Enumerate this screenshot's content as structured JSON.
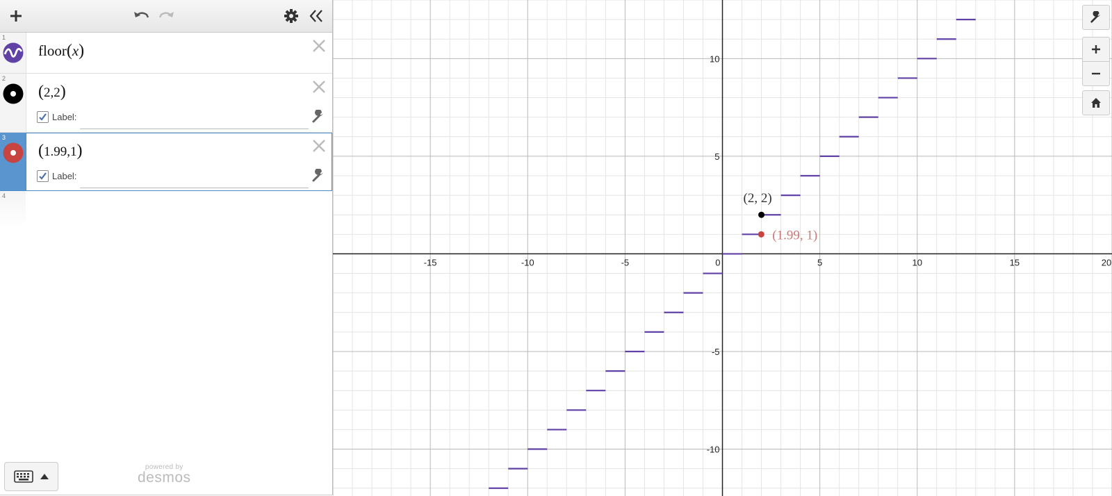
{
  "toolbar": {
    "add": "add-expression",
    "undo": "undo",
    "redo": "redo",
    "settings": "settings",
    "collapse": "collapse-list"
  },
  "expressions": [
    {
      "index": "1",
      "latex": "floor(x)",
      "color": "#6042a6",
      "type": "function"
    },
    {
      "index": "2",
      "latex": "(2,2)",
      "color": "#000000",
      "type": "point",
      "label_text": "Label:",
      "label_checked": true
    },
    {
      "index": "3",
      "latex": "(1.99,1)",
      "color": "#c74440",
      "type": "point",
      "label_text": "Label:",
      "label_checked": true,
      "selected": true
    },
    {
      "index": "4"
    }
  ],
  "footer": {
    "powered_by": "powered by",
    "brand": "desmos"
  },
  "graph": {
    "x_ticks": [
      "-15",
      "-10",
      "-5",
      "0",
      "5",
      "10",
      "15",
      "20"
    ],
    "y_ticks": [
      "10",
      "5",
      "-5",
      "-10"
    ],
    "point_labels": [
      "(2, 2)",
      "(1.99, 1)"
    ]
  },
  "colors": {
    "function": "#6042a6",
    "point_black": "#000000",
    "point_red": "#c74440",
    "selected": "#5a95cf"
  },
  "chart_data": {
    "type": "line",
    "function": "floor(x)",
    "xlim": [
      -20,
      20
    ],
    "ylim": [
      -12.4,
      13
    ],
    "grid": true,
    "steps": {
      "from": -12,
      "to": 12,
      "step_width": 1
    },
    "points": [
      {
        "x": 2,
        "y": 2,
        "label": "(2, 2)",
        "color": "#000000"
      },
      {
        "x": 1.99,
        "y": 1,
        "label": "(1.99, 1)",
        "color": "#c74440"
      }
    ]
  }
}
